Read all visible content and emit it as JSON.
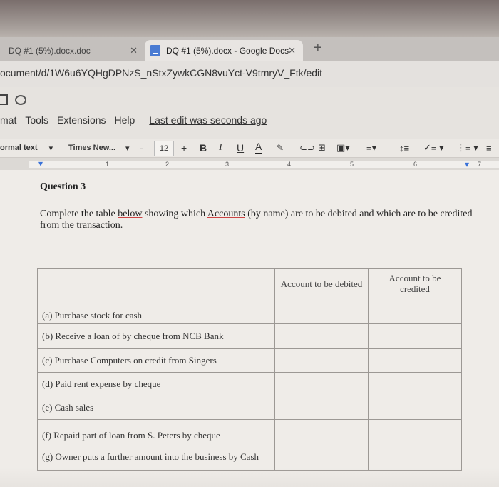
{
  "tabs": [
    {
      "label": "DQ #1 (5%).docx.doc"
    },
    {
      "label": "DQ #1 (5%).docx - Google Docs"
    }
  ],
  "address": {
    "url": "ocument/d/1W6u6YQHgDPNzS_nStxZywkCGN8vuYct-V9tmryV_Ftk/edit"
  },
  "menu": {
    "items": [
      "mat",
      "Tools",
      "Extensions",
      "Help"
    ],
    "last_edit": "Last edit was seconds ago"
  },
  "toolbar": {
    "style": "ormal text",
    "font": "Times New...",
    "font_size": "12",
    "minus": "-",
    "plus": "+",
    "bold": "B",
    "italic": "I",
    "underline": "U",
    "text_color": "A"
  },
  "ruler": {
    "numbers": [
      "1",
      "2",
      "3",
      "4",
      "5",
      "6",
      "7"
    ]
  },
  "document": {
    "question_title": "Question 3",
    "instruction_parts": [
      "Complete the table ",
      "below",
      " showing which ",
      "Accounts",
      " (by name) are to be debited and which are to be credited from the transaction."
    ],
    "table": {
      "headers": [
        "",
        "Account to be debited",
        "Account to be credited"
      ],
      "rows": [
        "(a) Purchase stock for cash",
        "(b) Receive a loan of by cheque from NCB Bank",
        "(c) Purchase Computers on credit from Singers",
        "(d) Paid rent expense by cheque",
        "(e) Cash sales",
        "(f) Repaid part of loan from S. Peters by cheque",
        "(g) Owner puts a further amount into the business by Cash"
      ]
    }
  }
}
